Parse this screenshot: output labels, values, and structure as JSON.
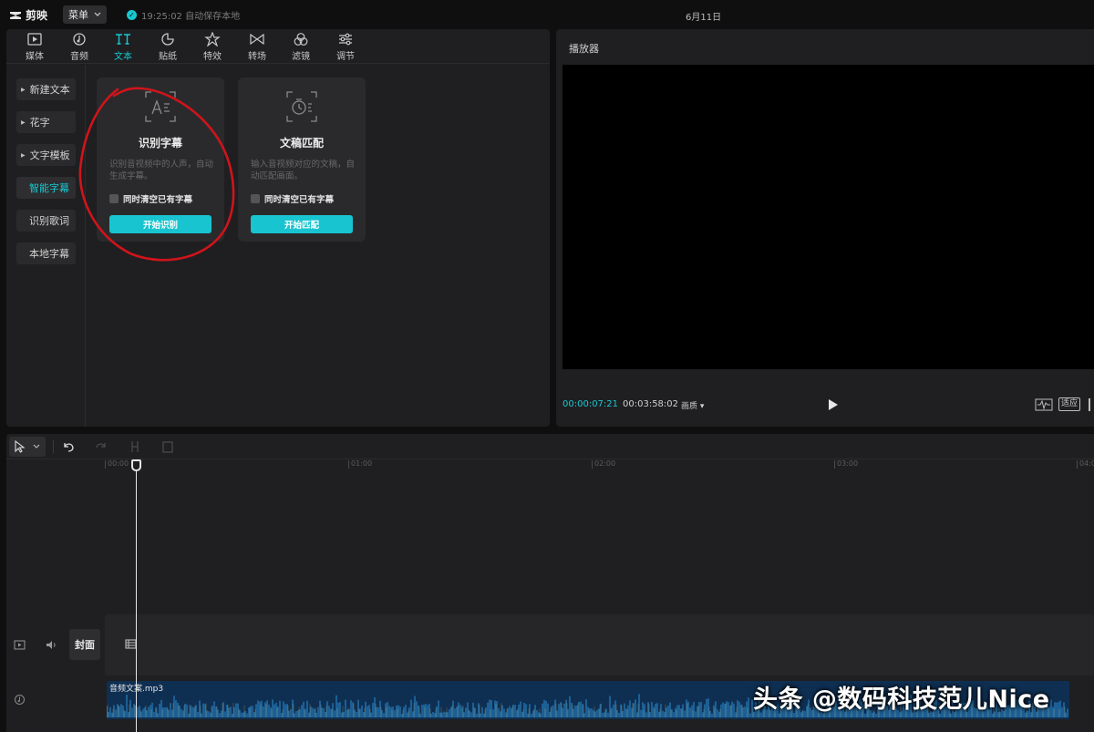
{
  "app": {
    "name": "剪映",
    "menu_label": "菜单",
    "autosave_text": "19:25:02 自动保存本地",
    "date": "6月11日"
  },
  "tabs": [
    {
      "label": "媒体",
      "icon": "media-icon"
    },
    {
      "label": "音频",
      "icon": "audio-icon"
    },
    {
      "label": "文本",
      "icon": "text-icon",
      "active": true
    },
    {
      "label": "贴纸",
      "icon": "sticker-icon"
    },
    {
      "label": "特效",
      "icon": "effects-icon"
    },
    {
      "label": "转场",
      "icon": "transition-icon"
    },
    {
      "label": "滤镜",
      "icon": "filter-icon"
    },
    {
      "label": "调节",
      "icon": "adjust-icon"
    }
  ],
  "sidebar": {
    "items": [
      {
        "label": "新建文本"
      },
      {
        "label": "花字"
      },
      {
        "label": "文字模板"
      },
      {
        "label": "智能字幕",
        "active": true
      },
      {
        "label": "识别歌词"
      },
      {
        "label": "本地字幕"
      }
    ]
  },
  "cards": [
    {
      "title": "识别字幕",
      "desc": "识别音视频中的人声，自动生成字幕。",
      "checkbox": "同时清空已有字幕",
      "button": "开始识别",
      "icon": "caption-recognize-icon"
    },
    {
      "title": "文稿匹配",
      "desc": "输入音视频对应的文稿，自动匹配画面。",
      "checkbox": "同时清空已有字幕",
      "button": "开始匹配",
      "icon": "script-match-icon"
    }
  ],
  "player": {
    "title": "播放器",
    "current_time": "00:00:07:21",
    "total_time": "00:03:58:02",
    "quality_label": "画质",
    "fit_label": "适应"
  },
  "timeline": {
    "ruler": [
      "00:00",
      "01:00",
      "02:00",
      "03:00",
      "04:0"
    ],
    "cover_label": "封面",
    "audio_clip": "音频文案.mp3"
  },
  "watermark": "头条 @数码科技范儿Nice",
  "colors": {
    "accent": "#18c8cf",
    "annotation": "#d0141b",
    "audio_clip": "#0f2f52"
  }
}
